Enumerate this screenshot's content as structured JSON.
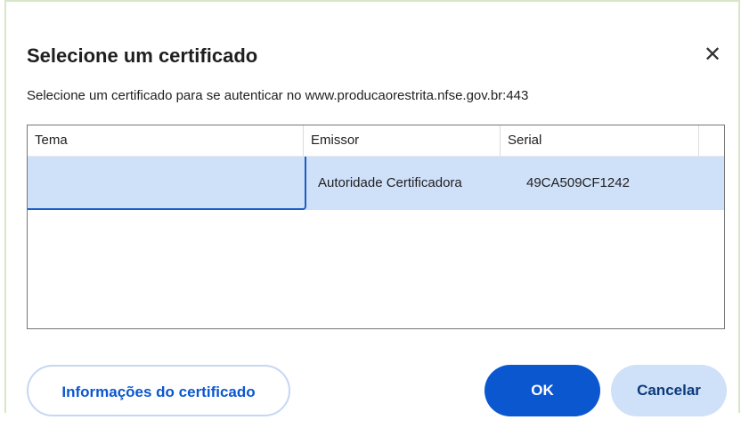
{
  "dialog": {
    "title": "Selecione um certificado",
    "close_glyph": "✕",
    "subtitle": "Selecione um certificado para se autenticar no www.producaorestrita.nfse.gov.br:443"
  },
  "table": {
    "columns": [
      "Tema",
      "Emissor",
      "Serial"
    ],
    "rows": [
      {
        "tema": "",
        "emissor": "Autoridade Certificadora",
        "serial": "49CA509CF1242",
        "selected": true
      },
      {
        "tema": "",
        "emissor": "",
        "serial": "",
        "selected": false
      }
    ]
  },
  "buttons": {
    "info": "Informações do certificado",
    "ok": "OK",
    "cancel": "Cancelar"
  },
  "colors": {
    "accent": "#0b57d0",
    "selection": "#cfe0f9"
  },
  "icons": {
    "close": "close-icon"
  }
}
